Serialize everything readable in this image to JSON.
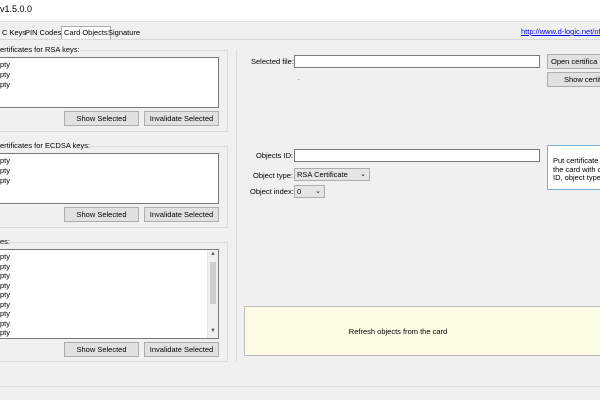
{
  "window": {
    "title": "v1.5.0.0"
  },
  "tabs": [
    {
      "label": "C Keys",
      "active": false
    },
    {
      "label": "PIN Codes",
      "active": false
    },
    {
      "label": "Card Objects",
      "active": true
    },
    {
      "label": "Signature",
      "active": false
    }
  ],
  "header_link": "http://www.d-logic.net/nfc-",
  "rsa_group": {
    "label": "ertificates for RSA keys:",
    "items": [
      "pty",
      "pty",
      "pty"
    ],
    "show_button": "Show Selected",
    "invalidate_button": "Invalidate Selected"
  },
  "ecdsa_group": {
    "label": "ertificates for ECDSA keys:",
    "items": [
      "pty",
      "pty",
      "pty"
    ],
    "show_button": "Show Selected",
    "invalidate_button": "Invalidate Selected"
  },
  "keys_group": {
    "label": "es:",
    "items": [
      "pty",
      "pty",
      "pty",
      "pty",
      "pty",
      "pty",
      "pty",
      "pty",
      "pty"
    ],
    "show_button": "Show Selected",
    "invalidate_button": "Invalidate Selected"
  },
  "right_panel": {
    "selected_file_label": "Selected file:",
    "selected_file_value": "",
    "small_dot": ".",
    "open_button": "Open certifica",
    "show_button": "Show certifi",
    "object_id_label": "Objects ID:",
    "object_id_value": "",
    "object_type_label": "Object type:",
    "object_type_value": "RSA Certificate",
    "object_index_label": "Object index:",
    "object_index_value": "0",
    "info_lines": [
      "Put certificate fro",
      "the card with de",
      "ID, object type a"
    ],
    "refresh_text": "Refresh objects from the card"
  },
  "colors": {
    "link": "#0000ee",
    "refresh_bg": "#fdfde6",
    "info_border": "#7ab0d4"
  }
}
